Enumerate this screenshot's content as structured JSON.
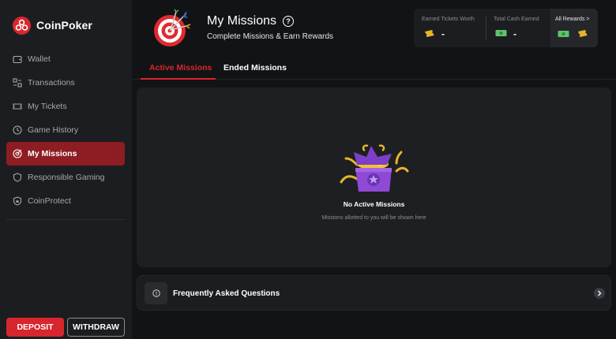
{
  "brand": {
    "name": "CoinPoker",
    "accent": "#d8262f"
  },
  "sidebar": {
    "items": [
      {
        "label": "Wallet",
        "icon": "wallet-icon",
        "active": false
      },
      {
        "label": "Transactions",
        "icon": "transactions-icon",
        "active": false
      },
      {
        "label": "My Tickets",
        "icon": "ticket-icon",
        "active": false
      },
      {
        "label": "Game History",
        "icon": "clock-icon",
        "active": false
      },
      {
        "label": "My Missions",
        "icon": "target-icon",
        "active": true
      },
      {
        "label": "Responsible Gaming",
        "icon": "shield-icon",
        "active": false
      },
      {
        "label": "CoinProtect",
        "icon": "shield-lock-icon",
        "active": false
      }
    ],
    "deposit_label": "DEPOSIT",
    "withdraw_label": "WITHDRAW"
  },
  "header": {
    "title": "My Missions",
    "help_symbol": "?",
    "subtitle": "Complete Missions & Earn Rewards"
  },
  "rewards": {
    "tickets_label": "Earned Tickets Worth",
    "tickets_value": "-",
    "cash_label": "Total Cash Earned",
    "cash_value": "-",
    "all_label": "All Rewards >"
  },
  "tabs": [
    {
      "label": "Active Missions",
      "active": true
    },
    {
      "label": "Ended Missions",
      "active": false
    }
  ],
  "empty_state": {
    "title": "No Active Missions",
    "subtitle": "Missions allotted to you will be shown here"
  },
  "faq": {
    "label": "Frequently Asked Questions"
  }
}
